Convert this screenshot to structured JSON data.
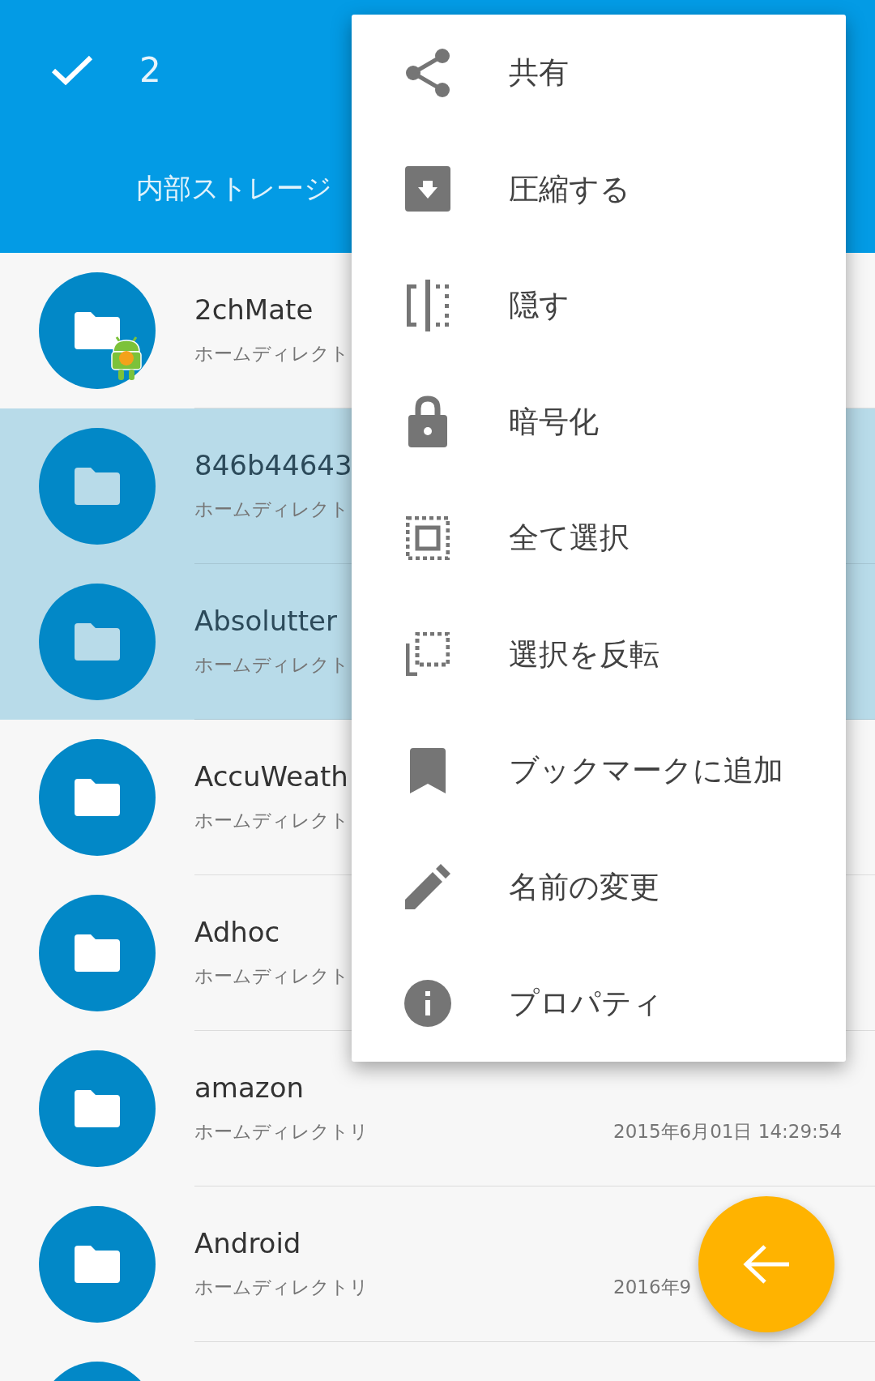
{
  "header": {
    "selection_count": "2",
    "location": "内部ストレージ"
  },
  "files": [
    {
      "name": "2chMate",
      "subtitle": "ホームディレクト",
      "selected": false,
      "badge": true
    },
    {
      "name": "846b44643",
      "subtitle": "ホームディレクト",
      "selected": true,
      "badge": false
    },
    {
      "name": "Absolutter",
      "subtitle": "ホームディレクト",
      "selected": true,
      "badge": false
    },
    {
      "name": "AccuWeath",
      "subtitle": "ホームディレクト",
      "selected": false,
      "badge": false
    },
    {
      "name": "Adhoc",
      "subtitle": "ホームディレクト",
      "selected": false,
      "badge": false
    },
    {
      "name": "amazon",
      "subtitle": "ホームディレクトリ",
      "date": "2015年6月01日 14:29:54",
      "selected": false,
      "badge": false
    },
    {
      "name": "Android",
      "subtitle": "ホームディレクトリ",
      "date": "2016年9",
      "selected": false,
      "badge": false
    },
    {
      "selected": false,
      "badge": false
    }
  ],
  "menu": [
    {
      "label": "共有"
    },
    {
      "label": "圧縮する"
    },
    {
      "label": "隠す"
    },
    {
      "label": "暗号化"
    },
    {
      "label": "全て選択"
    },
    {
      "label": "選択を反転"
    },
    {
      "label": "ブックマークに追加"
    },
    {
      "label": "名前の変更"
    },
    {
      "label": "プロパティ"
    }
  ]
}
